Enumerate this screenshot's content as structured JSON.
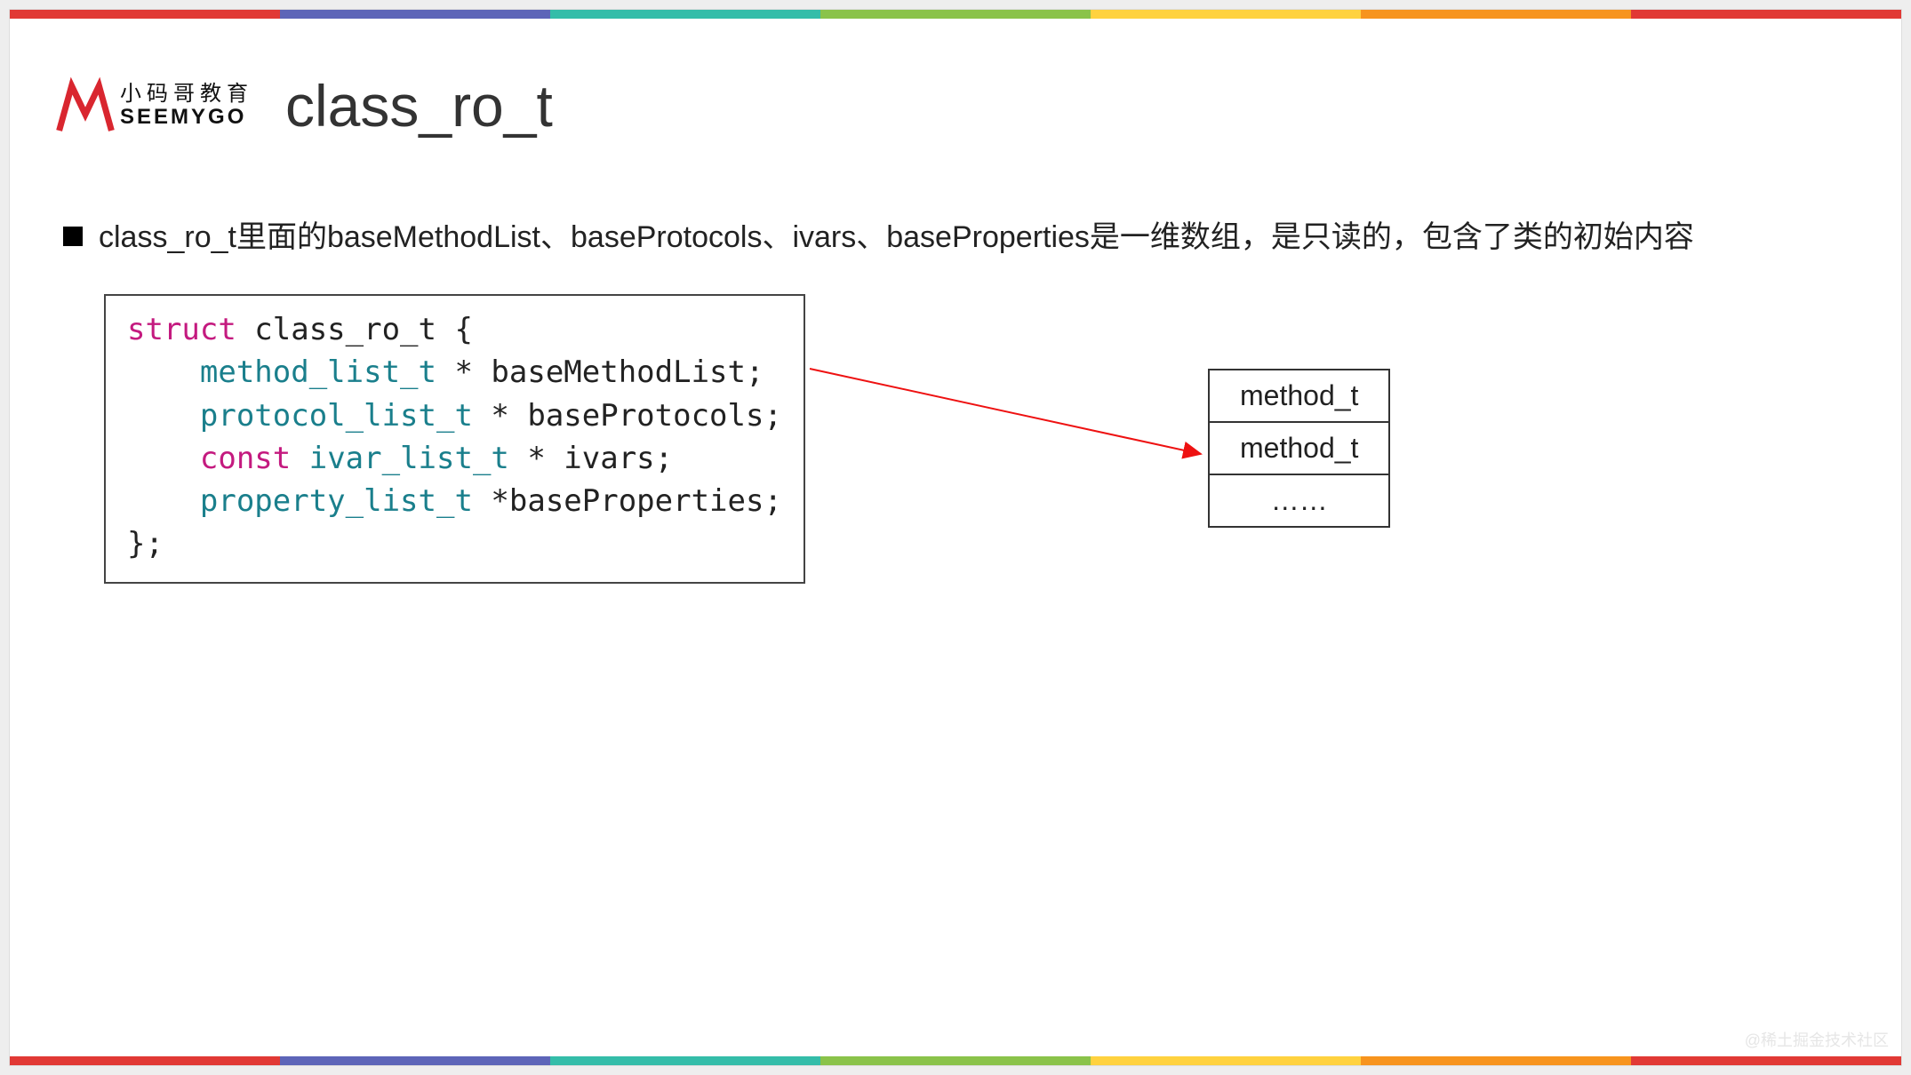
{
  "colors": {
    "stripes": [
      "#e13935",
      "#5d65b8",
      "#34bda9",
      "#8ac34a",
      "#ffd23f",
      "#f7941e",
      "#e13935"
    ]
  },
  "logo": {
    "cn": "小码哥教育",
    "en": "SEEMYGO"
  },
  "title": "class_ro_t",
  "bullet": "class_ro_t里面的baseMethodList、baseProtocols、ivars、baseProperties是一维数组，是只读的，包含了类的初始内容",
  "code": {
    "l1a": "struct",
    "l1b": " class_ro_t {",
    "indent": "    ",
    "l2a": "method_list_t",
    "l2b": " * baseMethodList;",
    "l3a": "protocol_list_t",
    "l3b": " * baseProtocols;",
    "l4a": "const ",
    "l4b": "ivar_list_t",
    "l4c": " * ivars;",
    "l5a": "property_list_t",
    "l5b": " *baseProperties;",
    "l6": "};"
  },
  "array_cells": {
    "c1": "method_t",
    "c2": "method_t",
    "c3": "……"
  },
  "watermark": "@稀土掘金技术社区"
}
